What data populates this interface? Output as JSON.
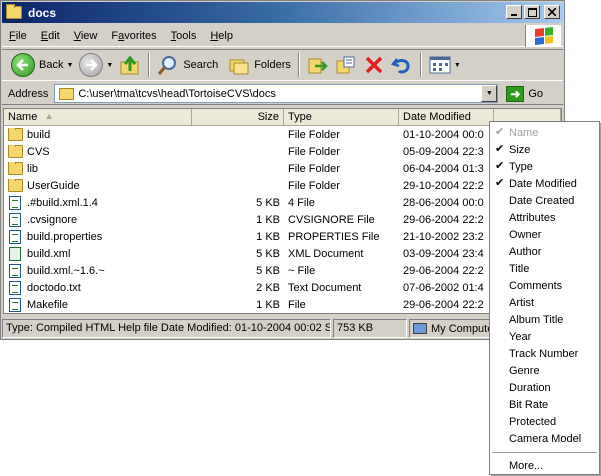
{
  "window": {
    "title": "docs"
  },
  "menu": [
    "File",
    "Edit",
    "View",
    "Favorites",
    "Tools",
    "Help"
  ],
  "menu_underline": [
    "F",
    "E",
    "V",
    "a",
    "T",
    "H"
  ],
  "toolbar": {
    "back_label": "Back",
    "search_label": "Search",
    "folders_label": "Folders"
  },
  "address": {
    "label": "Address",
    "value": "C:\\user\\tma\\tcvs\\head\\TortoiseCVS\\docs",
    "go_label": "Go"
  },
  "columns": {
    "name": "Name",
    "size": "Size",
    "type": "Type",
    "date": "Date Modified"
  },
  "files": [
    {
      "name": "build",
      "size": "",
      "type": "File Folder",
      "date": "01-10-2004 00:0",
      "icon": "folder"
    },
    {
      "name": "CVS",
      "size": "",
      "type": "File Folder",
      "date": "05-09-2004 22:3",
      "icon": "folder"
    },
    {
      "name": "lib",
      "size": "",
      "type": "File Folder",
      "date": "06-04-2004 01:3",
      "icon": "folder"
    },
    {
      "name": "UserGuide",
      "size": "",
      "type": "File Folder",
      "date": "29-10-2004 22:2",
      "icon": "folder"
    },
    {
      "name": ".#build.xml.1.4",
      "size": "5 KB",
      "type": "4 File",
      "date": "28-06-2004 00:0",
      "icon": "file"
    },
    {
      "name": ".cvsignore",
      "size": "1 KB",
      "type": "CVSIGNORE File",
      "date": "29-06-2004 22:2",
      "icon": "file"
    },
    {
      "name": "build.properties",
      "size": "1 KB",
      "type": "PROPERTIES File",
      "date": "21-10-2002 23:2",
      "icon": "file"
    },
    {
      "name": "build.xml",
      "size": "5 KB",
      "type": "XML Document",
      "date": "03-09-2004 23:4",
      "icon": "xml"
    },
    {
      "name": "build.xml.~1.6.~",
      "size": "5 KB",
      "type": "~ File",
      "date": "29-06-2004 22:2",
      "icon": "file"
    },
    {
      "name": "doctodo.txt",
      "size": "2 KB",
      "type": "Text Document",
      "date": "07-06-2002 01:4",
      "icon": "file"
    },
    {
      "name": "Makefile",
      "size": "1 KB",
      "type": "File",
      "date": "29-06-2004 22:2",
      "icon": "file"
    }
  ],
  "status": {
    "info": "Type: Compiled HTML Help file Date Modified: 01-10-2004 00:02 Siz",
    "size": "753 KB",
    "location": "My Computer"
  },
  "context_menu": [
    {
      "label": "Name",
      "checked": true,
      "disabled": true
    },
    {
      "label": "Size",
      "checked": true,
      "disabled": false
    },
    {
      "label": "Type",
      "checked": true,
      "disabled": false
    },
    {
      "label": "Date Modified",
      "checked": true,
      "disabled": false
    },
    {
      "label": "Date Created",
      "checked": false,
      "disabled": false
    },
    {
      "label": "Attributes",
      "checked": false,
      "disabled": false
    },
    {
      "label": "Owner",
      "checked": false,
      "disabled": false
    },
    {
      "label": "Author",
      "checked": false,
      "disabled": false
    },
    {
      "label": "Title",
      "checked": false,
      "disabled": false
    },
    {
      "label": "Comments",
      "checked": false,
      "disabled": false
    },
    {
      "label": "Artist",
      "checked": false,
      "disabled": false
    },
    {
      "label": "Album Title",
      "checked": false,
      "disabled": false
    },
    {
      "label": "Year",
      "checked": false,
      "disabled": false
    },
    {
      "label": "Track Number",
      "checked": false,
      "disabled": false
    },
    {
      "label": "Genre",
      "checked": false,
      "disabled": false
    },
    {
      "label": "Duration",
      "checked": false,
      "disabled": false
    },
    {
      "label": "Bit Rate",
      "checked": false,
      "disabled": false
    },
    {
      "label": "Protected",
      "checked": false,
      "disabled": false
    },
    {
      "label": "Camera Model",
      "checked": false,
      "disabled": false
    }
  ],
  "context_more": "More...",
  "icons": [
    "folder-icon",
    "back-arrow-icon",
    "forward-arrow-icon",
    "up-folder-icon",
    "search-icon",
    "folders-icon",
    "move-to-icon",
    "copy-to-icon",
    "delete-icon",
    "undo-icon",
    "views-icon",
    "windows-logo-icon",
    "go-icon",
    "my-computer-icon"
  ]
}
